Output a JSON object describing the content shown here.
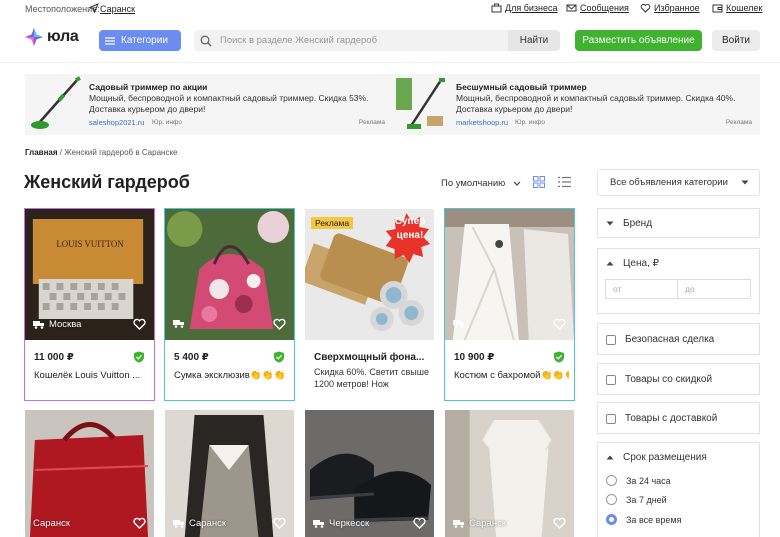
{
  "topbar": {
    "location_label": "Местоположение:",
    "city": "Саранск",
    "links": [
      "Для бизнеса",
      "Сообщения",
      "Избранное",
      "Кошелек"
    ]
  },
  "header": {
    "logo": "юла",
    "categories_label": "Категории",
    "search_placeholder": "Поиск в разделе Женский гардероб",
    "find_label": "Найти",
    "post_label": "Разместить объявление",
    "login_label": "Войти"
  },
  "ads": [
    {
      "title": "Садовый триммер по акции",
      "desc": "Мощный, беспроводной и компактный садовый триммер. Скидка 53%. Доставка курьером до двери!",
      "source": "saleshop2021.ru",
      "info": "Юр. инфо",
      "mark": "Реклама"
    },
    {
      "title": "Бесшумный садовый триммер",
      "desc": "Мощный, беспроводной и компактный садовый триммер. Скидка 40%. Доставка курьером до двери!",
      "source": "marketshoop.ru",
      "info": "Юр. инфо",
      "mark": "Реклама"
    }
  ],
  "breadcrumb": {
    "home": "Главная",
    "sep": "/",
    "current": "Женский гардероб в Саранске"
  },
  "page_title": "Женский гардероб",
  "sort_label": "По умолчанию",
  "listings": [
    {
      "city": "Москва",
      "price": "11 000 ₽",
      "title": "Кошелёк Louis Vuitton ...",
      "photo_text": "LOUIS VUITTON"
    },
    {
      "city": "",
      "price": "5 400 ₽",
      "title": "Сумка эксклюзив👏👏👏"
    },
    {
      "badge": "Реклама",
      "promo": "Супер цена!",
      "title": "Сверхмощный фона...",
      "desc": "Скидка 60%. Светит свыше 1200 метров! Нож"
    },
    {
      "city": "",
      "price": "10 900 ₽",
      "title": "Костюм с бахромой👏👏👏"
    },
    {
      "city": "Саранск"
    },
    {
      "city": "Саранск"
    },
    {
      "city": "Черкесск"
    },
    {
      "city": "Саранск"
    }
  ],
  "sidebar": {
    "category_select": "Все объявления категории",
    "brand": "Бренд",
    "price": "Цена, ₽",
    "price_from": "от",
    "price_to": "до",
    "safe_deal": "Безопасная сделка",
    "discount": "Товары со скидкой",
    "delivery": "Товары с доставкой",
    "period": "Срок размещения",
    "period_options": [
      "За 24 часа",
      "За 7 дней",
      "За все время"
    ],
    "period_selected": "За все время"
  },
  "colors": {
    "accent": "#6c8cf0",
    "green": "#3fb22f",
    "link": "#3e6fc2"
  }
}
